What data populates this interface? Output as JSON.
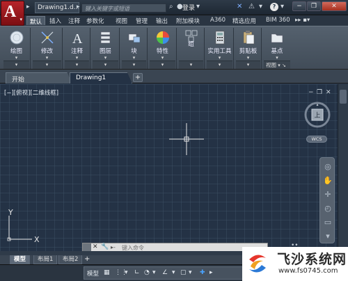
{
  "title_bar": {
    "document_title": "Drawing1.d...",
    "search_placeholder": "键入关键字或短语",
    "login_label": "登录"
  },
  "ribbon_tabs": [
    "默认",
    "插入",
    "注释",
    "参数化",
    "视图",
    "管理",
    "输出",
    "附加模块",
    "A360",
    "精选应用",
    "BIM 360"
  ],
  "ribbon_groups": [
    {
      "label": "绘图",
      "icon": "draw-icon"
    },
    {
      "label": "修改",
      "icon": "modify-icon"
    },
    {
      "label": "注释",
      "icon": "annotation-icon"
    },
    {
      "label": "图层",
      "icon": "layers-icon"
    },
    {
      "label": "块",
      "icon": "block-icon"
    },
    {
      "label": "特性",
      "icon": "properties-icon"
    },
    {
      "label": "组",
      "icon": "group-icon"
    },
    {
      "label": "实用工具",
      "icon": "calculator-icon"
    },
    {
      "label": "剪贴板",
      "icon": "clipboard-icon"
    },
    {
      "label": "基点",
      "icon": "basepoint-icon"
    }
  ],
  "view_group_label": "视图",
  "doc_tabs": [
    "开始",
    "Drawing1"
  ],
  "viewport_label": "[−][俯视][二维线框]",
  "viewcube_face": "上",
  "wcs_label": "WCS",
  "ucs": {
    "x_label": "X",
    "y_label": "Y"
  },
  "command_line": {
    "placeholder": "键入命令"
  },
  "layout_tabs": [
    "模型",
    "布局1",
    "布局2"
  ],
  "status_bar": {
    "model_label": "模型"
  },
  "watermark": {
    "title": "飞沙系统网",
    "url": "www.fs0745.com"
  }
}
